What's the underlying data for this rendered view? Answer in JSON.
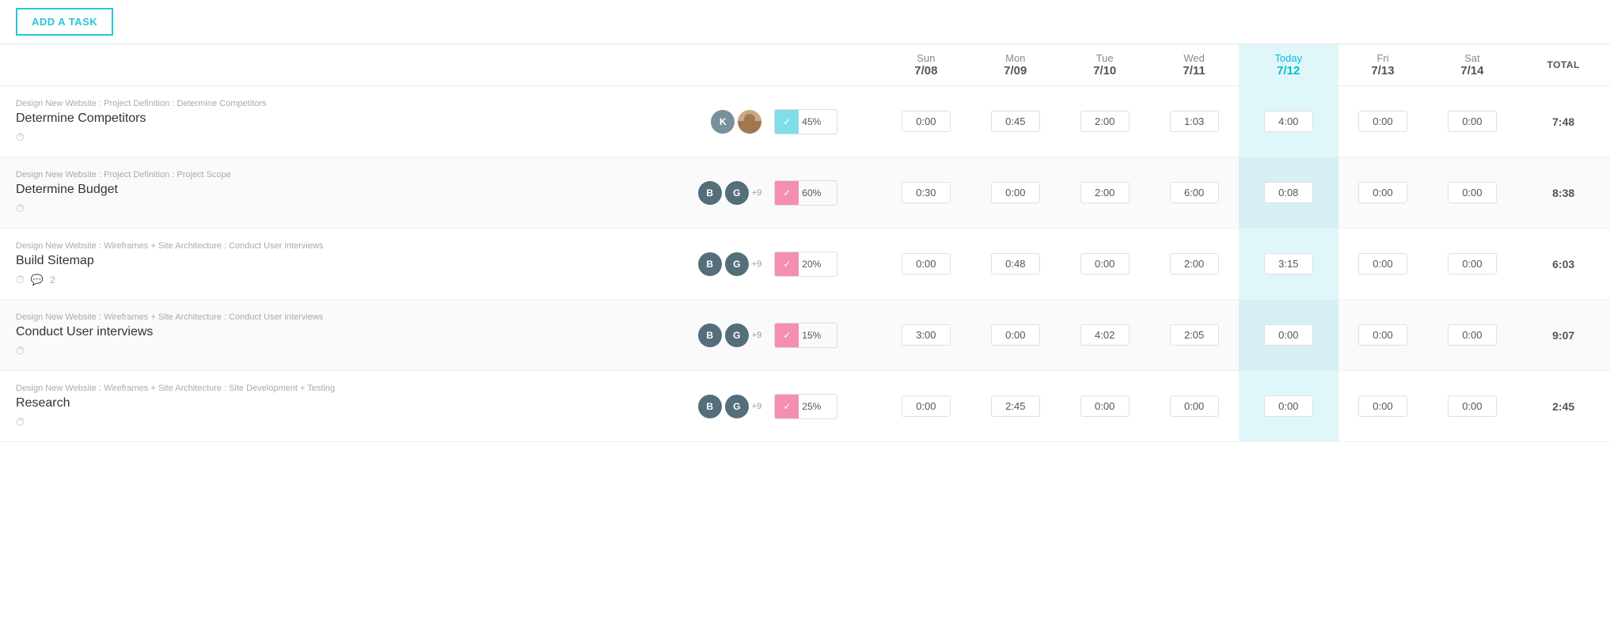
{
  "toolbar": {
    "add_task_label": "ADD A TASK"
  },
  "header": {
    "empty_label": "",
    "total_label": "TOTAL",
    "days": [
      {
        "name": "Sun",
        "date": "7/08",
        "is_today": false
      },
      {
        "name": "Mon",
        "date": "7/09",
        "is_today": false
      },
      {
        "name": "Tue",
        "date": "7/10",
        "is_today": false
      },
      {
        "name": "Wed",
        "date": "7/11",
        "is_today": false
      },
      {
        "name": "Today",
        "date": "7/12",
        "is_today": true
      },
      {
        "name": "Fri",
        "date": "7/13",
        "is_today": false
      },
      {
        "name": "Sat",
        "date": "7/14",
        "is_today": false
      }
    ]
  },
  "tasks": [
    {
      "id": 1,
      "breadcrumb": "Design New Website : Project Definition : Determine Competitors",
      "name": "Determine Competitors",
      "assignees": [
        {
          "type": "letter",
          "letter": "K",
          "color": "#78909c"
        },
        {
          "type": "photo"
        }
      ],
      "extra_count": null,
      "progress": 45,
      "progress_type": "cyan",
      "times": [
        "0:00",
        "0:45",
        "2:00",
        "1:03",
        "4:00",
        "0:00",
        "0:00"
      ],
      "total": "7:48",
      "has_clock": true,
      "comments": null,
      "alt": false
    },
    {
      "id": 2,
      "breadcrumb": "Design New Website : Project Definition : Project Scope",
      "name": "Determine Budget",
      "assignees": [
        {
          "type": "letter",
          "letter": "B",
          "color": "#546e7a"
        },
        {
          "type": "letter",
          "letter": "G",
          "color": "#546e7a"
        }
      ],
      "extra_count": "+9",
      "progress": 60,
      "progress_type": "pink",
      "times": [
        "0:30",
        "0:00",
        "2:00",
        "6:00",
        "0:08",
        "0:00",
        "0:00"
      ],
      "total": "8:38",
      "has_clock": true,
      "comments": null,
      "alt": true
    },
    {
      "id": 3,
      "breadcrumb": "Design New Website : Wireframes + Site Architecture : Conduct User interviews",
      "name": "Build Sitemap",
      "assignees": [
        {
          "type": "letter",
          "letter": "B",
          "color": "#546e7a"
        },
        {
          "type": "letter",
          "letter": "G",
          "color": "#546e7a"
        }
      ],
      "extra_count": "+9",
      "progress": 20,
      "progress_type": "pink",
      "times": [
        "0:00",
        "0:48",
        "0:00",
        "2:00",
        "3:15",
        "0:00",
        "0:00"
      ],
      "total": "6:03",
      "has_clock": true,
      "comments": "2",
      "alt": false
    },
    {
      "id": 4,
      "breadcrumb": "Design New Website : Wireframes + Site Architecture : Conduct User interviews",
      "name": "Conduct User interviews",
      "assignees": [
        {
          "type": "letter",
          "letter": "B",
          "color": "#546e7a"
        },
        {
          "type": "letter",
          "letter": "G",
          "color": "#546e7a"
        }
      ],
      "extra_count": "+9",
      "progress": 15,
      "progress_type": "pink",
      "times": [
        "3:00",
        "0:00",
        "4:02",
        "2:05",
        "0:00",
        "0:00",
        "0:00"
      ],
      "total": "9:07",
      "has_clock": true,
      "comments": null,
      "alt": true
    },
    {
      "id": 5,
      "breadcrumb": "Design New Website : Wireframes + Site Architecture : Site Development + Testing",
      "name": "Research",
      "assignees": [
        {
          "type": "letter",
          "letter": "B",
          "color": "#546e7a"
        },
        {
          "type": "letter",
          "letter": "G",
          "color": "#546e7a"
        }
      ],
      "extra_count": "+9",
      "progress": 25,
      "progress_type": "pink",
      "times": [
        "0:00",
        "2:45",
        "0:00",
        "0:00",
        "0:00",
        "0:00",
        "0:00"
      ],
      "total": "2:45",
      "has_clock": true,
      "comments": null,
      "alt": false
    }
  ]
}
